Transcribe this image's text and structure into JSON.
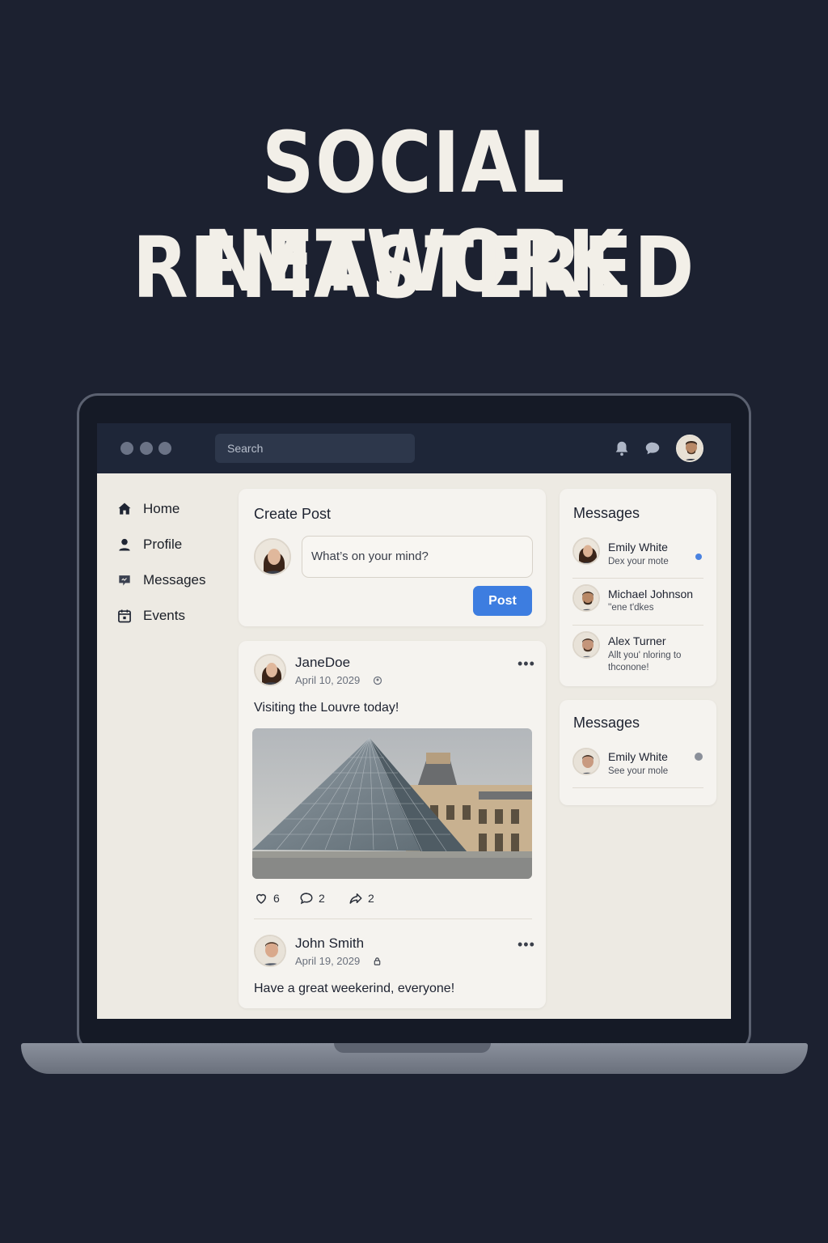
{
  "poster": {
    "headline_line1": "SOCIAL NETWORK",
    "headline_line2": "REMASTERED"
  },
  "topbar": {
    "search_placeholder": "Search",
    "icons": [
      "bell-icon",
      "chat-icon",
      "user-avatar"
    ]
  },
  "sidebar": {
    "items": [
      {
        "label": "Home",
        "icon": "home-icon"
      },
      {
        "label": "Profile",
        "icon": "profile-icon"
      },
      {
        "label": "Messages",
        "icon": "messages-icon"
      },
      {
        "label": "Events",
        "icon": "calendar-icon"
      }
    ]
  },
  "create_post": {
    "title": "Create Post",
    "placeholder": "What’s on your mind?",
    "button": "Post"
  },
  "feed": {
    "posts": [
      {
        "author": "JaneDoe",
        "date": "April 10, 2029",
        "text": "Visiting the Louvre today!",
        "likes": "6",
        "comments": "2",
        "shares": "2"
      },
      {
        "author": "John Smith",
        "date": "April 19, 2029",
        "text": "Have a great weekerind, everyone!"
      }
    ]
  },
  "messages_panel": {
    "title": "Messages",
    "items": [
      {
        "name": "Emily White",
        "preview": "Dex your mote",
        "status": "unread",
        "status_color": "#4a82e0"
      },
      {
        "name": "Michael Johnson",
        "preview": "''ene t'dkes"
      },
      {
        "name": "Alex Turner",
        "preview": "Allt you' nloring to thconone!"
      }
    ]
  },
  "messages_panel_2": {
    "title": "Messages",
    "items": [
      {
        "name": "Emily White",
        "preview": "See your mole",
        "status": "read",
        "status_color": "#8a8f99"
      }
    ]
  },
  "colors": {
    "background": "#1c2130",
    "accent": "#3d7de0",
    "topbar": "#1e2638",
    "screen": "#edeae3"
  }
}
